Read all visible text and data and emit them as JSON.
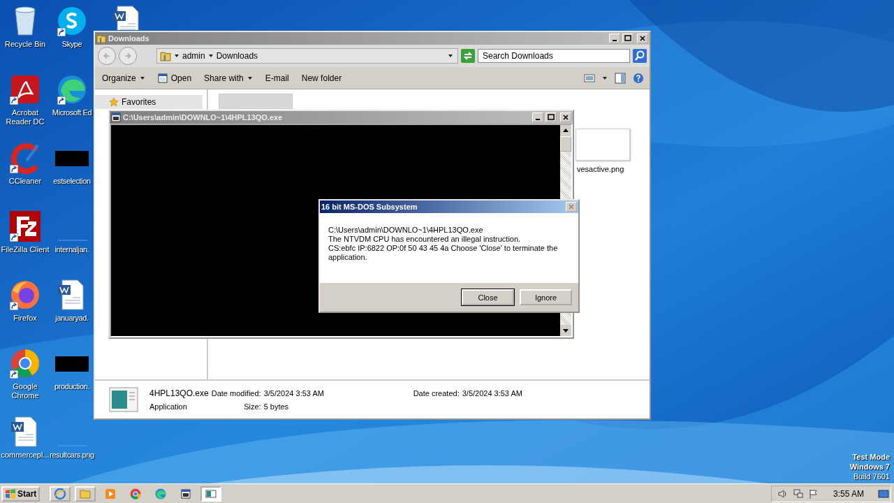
{
  "desktop": {
    "icons": [
      {
        "label": "Recycle Bin",
        "kind": "recycle",
        "shortcut": false
      },
      {
        "label": "Acrobat Reader DC",
        "kind": "acrobat",
        "shortcut": true
      },
      {
        "label": "CCleaner",
        "kind": "ccleaner",
        "shortcut": true
      },
      {
        "label": "FileZilla Client",
        "kind": "filezilla",
        "shortcut": true
      },
      {
        "label": "Firefox",
        "kind": "firefox",
        "shortcut": true
      },
      {
        "label": "Google Chrome",
        "kind": "chrome",
        "shortcut": true
      },
      {
        "label": "commercepl...",
        "kind": "word",
        "shortcut": false
      },
      {
        "label": "Skype",
        "kind": "skype",
        "shortcut": true
      },
      {
        "label": "Microsoft Ed",
        "kind": "edge",
        "shortcut": true
      },
      {
        "label": "estselection",
        "kind": "black",
        "shortcut": false
      },
      {
        "label": "internaljan.",
        "kind": "blank",
        "shortcut": false
      },
      {
        "label": "januaryad.",
        "kind": "word",
        "shortcut": false
      },
      {
        "label": "production.",
        "kind": "black",
        "shortcut": false
      },
      {
        "label": "resultcars.png",
        "kind": "blank",
        "shortcut": false
      },
      {
        "kind": "word",
        "shortcut": false
      }
    ],
    "os_info": [
      "Test Mode",
      "Windows 7",
      "Build 7601"
    ]
  },
  "explorer": {
    "title": "Downloads",
    "breadcrumb": [
      "admin",
      "Downloads"
    ],
    "search": {
      "placeholder": "Search Downloads"
    },
    "toolbar": [
      {
        "label": "Organize",
        "icon": false,
        "dropdown": true
      },
      {
        "label": "Open",
        "icon": true,
        "dropdown": false
      },
      {
        "label": "Share with",
        "icon": false,
        "dropdown": true
      },
      {
        "label": "E-mail",
        "icon": false,
        "dropdown": false
      },
      {
        "label": "New folder",
        "icon": false,
        "dropdown": false
      }
    ],
    "nav": [
      "Favorites"
    ],
    "files": [
      {
        "label": "vesactive.png"
      }
    ],
    "details": {
      "name": "4HPL13QO.exe",
      "type": "Application",
      "fields": [
        {
          "label": "Date modified:",
          "value": "3/5/2024 3:53 AM"
        },
        {
          "label": "Date created:",
          "value": "3/5/2024 3:53 AM"
        },
        {
          "label": "Size:",
          "value": "5 bytes"
        }
      ]
    }
  },
  "console": {
    "title": "C:\\Users\\admin\\DOWNLO~1\\4HPL13QO.exe"
  },
  "dialog": {
    "title": "16 bit MS-DOS Subsystem",
    "lines": [
      "C:\\Users\\admin\\DOWNLO~1\\4HPL13QO.exe",
      "The NTVDM CPU has encountered an illegal instruction.",
      "CS:ebfc IP:6822 OP:0f 50 43 45 4a Choose 'Close' to terminate the application."
    ],
    "buttons": [
      {
        "label": "Close",
        "default": true
      },
      {
        "label": "Ignore",
        "default": false
      }
    ]
  },
  "taskbar": {
    "start": "Start",
    "items": [
      {
        "kind": "ie",
        "active": false
      },
      {
        "kind": "folder",
        "active": false
      },
      {
        "kind": "media",
        "active": false
      },
      {
        "kind": "chrome",
        "active": false
      },
      {
        "kind": "edge",
        "active": false
      },
      {
        "kind": "dos",
        "active": false
      },
      {
        "kind": "window",
        "active": true
      }
    ],
    "time": "3:55 AM"
  }
}
